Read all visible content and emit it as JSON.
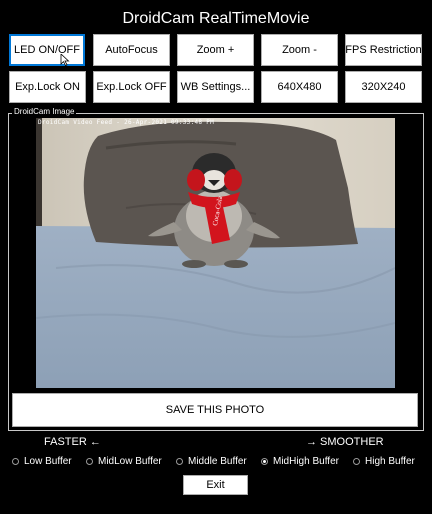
{
  "window": {
    "title": "DroidCam RealTimeMovie"
  },
  "toolbar": {
    "row1": [
      "LED ON/OFF",
      "AutoFocus",
      "Zoom +",
      "Zoom -",
      "FPS Restriction"
    ],
    "row2": [
      "Exp.Lock ON",
      "Exp.Lock OFF",
      "WB Settings...",
      "640X480",
      "320X240"
    ]
  },
  "image_group": {
    "label": "DroidCam Image",
    "overlay_text": "DroidCam Video Feed - 26-Apr-2021 09:33:48 PM"
  },
  "save_button": {
    "label": "SAVE THIS PHOTO"
  },
  "speed": {
    "faster_label": "FASTER ←",
    "smoother_label": "→ SMOOTHER"
  },
  "buffer_options": [
    {
      "label": "Low Buffer",
      "selected": false
    },
    {
      "label": "MidLow Buffer",
      "selected": false
    },
    {
      "label": "Middle Buffer",
      "selected": false
    },
    {
      "label": "MidHigh Buffer",
      "selected": true
    },
    {
      "label": "High Buffer",
      "selected": false
    }
  ],
  "exit_button": {
    "label": "Exit"
  },
  "colors": {
    "background": "#000000",
    "button_face": "#ffffff",
    "focus_border": "#0078d7",
    "text": "#ffffff"
  }
}
